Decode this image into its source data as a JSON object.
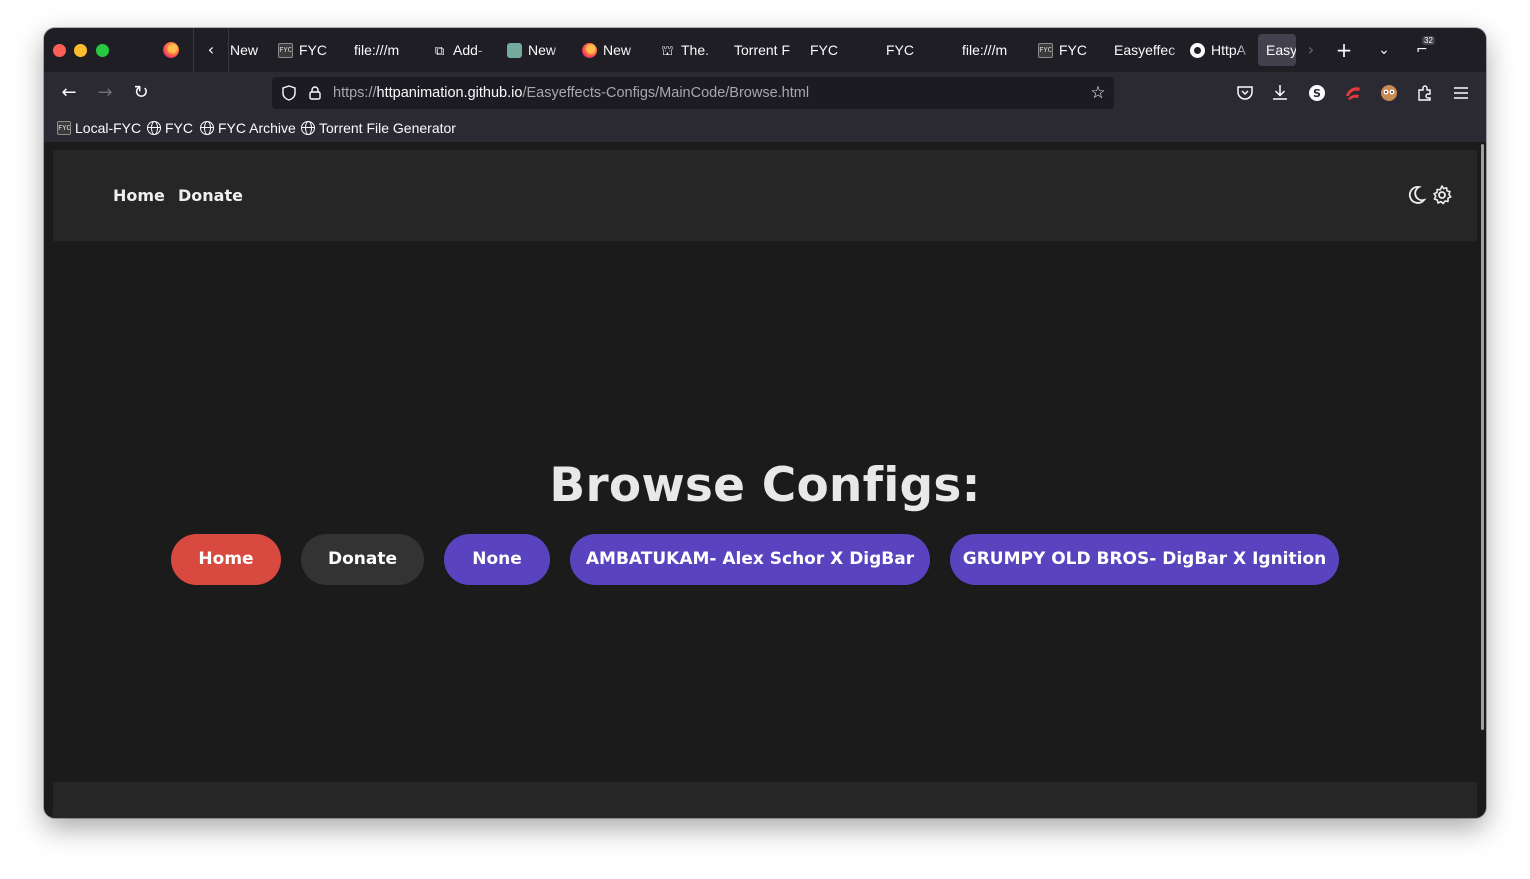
{
  "browser": {
    "tabs": [
      {
        "label": "New",
        "icon": "extension-icon"
      },
      {
        "label": "FYC",
        "icon": "fyc-favicon-icon"
      },
      {
        "label": "file:///m",
        "icon": ""
      },
      {
        "label": "Add-",
        "icon": "extension-icon"
      },
      {
        "label": "New",
        "icon": "chatgpt-icon"
      },
      {
        "label": "New",
        "icon": "firefox-icon"
      },
      {
        "label": "The.",
        "icon": "archive-icon"
      },
      {
        "label": "Torrent F",
        "icon": ""
      },
      {
        "label": "FYC",
        "icon": ""
      },
      {
        "label": "FYC",
        "icon": ""
      },
      {
        "label": "file:///m",
        "icon": ""
      },
      {
        "label": "FYC",
        "icon": "fyc-favicon-icon"
      },
      {
        "label": "Easyeffec",
        "icon": ""
      },
      {
        "label": "HttpA",
        "icon": "github-icon"
      },
      {
        "label": "Easy",
        "icon": "",
        "active": true
      }
    ],
    "tab_count_badge": "32",
    "url": {
      "scheme": "https://",
      "host": "httpanimation.github.io",
      "path": "/Easyeffects-Configs/MainCode/Browse.html"
    },
    "bookmarks": [
      {
        "label": "Local-FYC",
        "icon": "fyc-favicon-icon"
      },
      {
        "label": "FYC",
        "icon": "globe-icon"
      },
      {
        "label": "FYC Archive",
        "icon": "globe-icon"
      },
      {
        "label": "Torrent File Generator",
        "icon": "globe-icon"
      }
    ]
  },
  "site": {
    "nav": {
      "home": "Home",
      "donate": "Donate"
    },
    "heading": "Browse Configs:",
    "buttons": {
      "home": "Home",
      "donate": "Donate",
      "configs": [
        "None",
        "AMBATUKAM- Alex Schor X DigBar",
        "GRUMPY OLD BROS- DigBar X Ignition"
      ]
    }
  },
  "colors": {
    "home_button": "#d84a3f",
    "donate_button": "#333333",
    "config_button": "#5a43be",
    "page_background": "#1c1b1c",
    "header_background": "#262626"
  }
}
